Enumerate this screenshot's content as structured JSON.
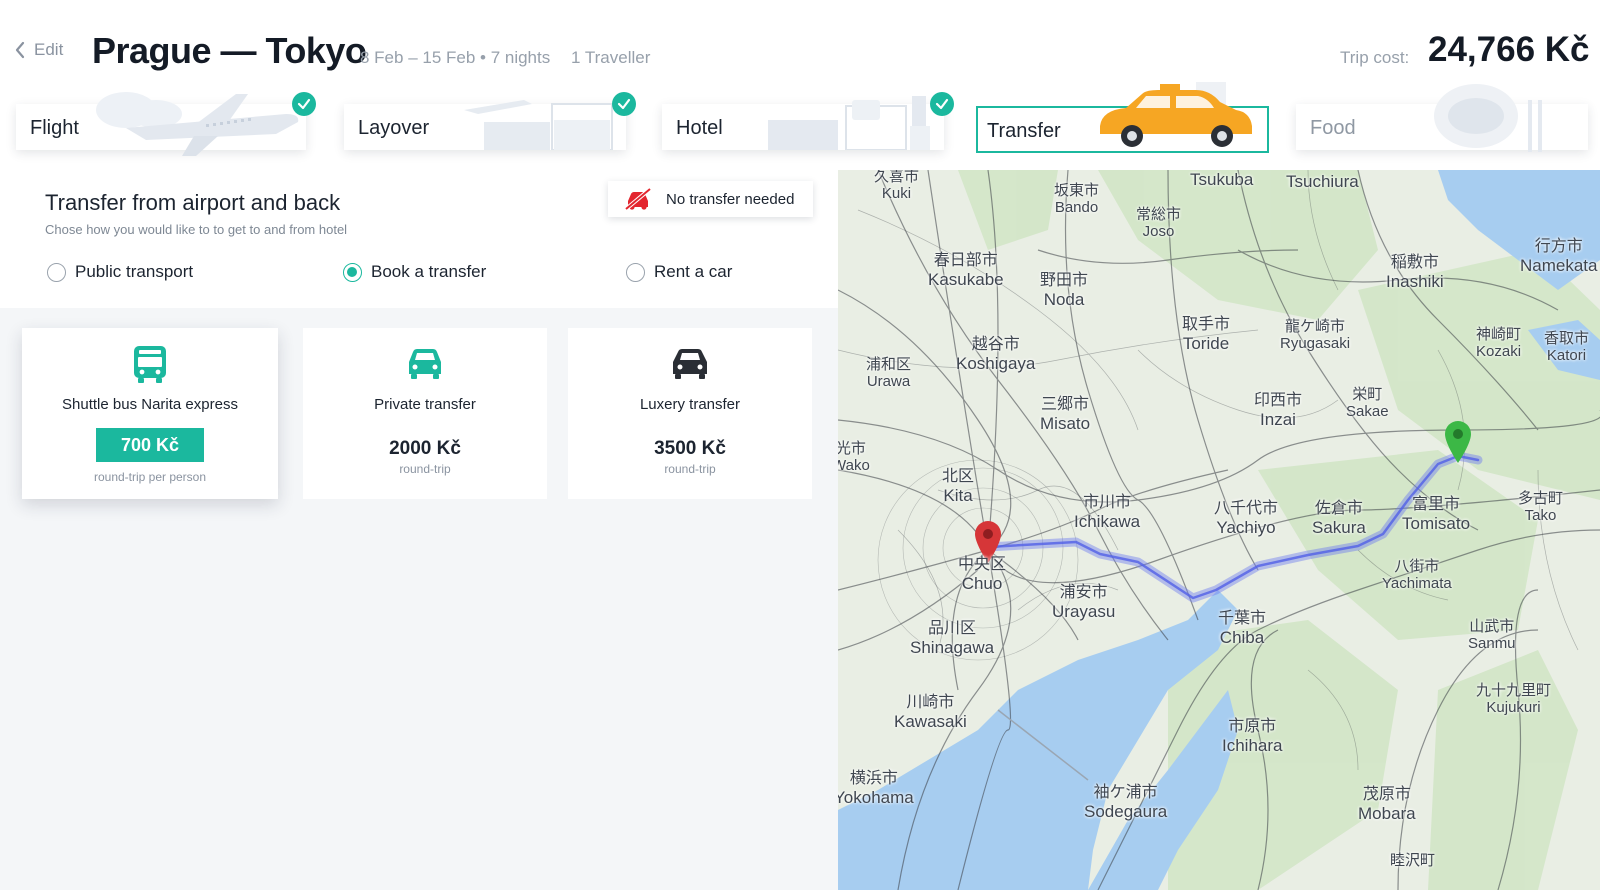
{
  "header": {
    "edit_label": "Edit",
    "title": "Prague — Tokyo",
    "dates": "8 Feb – 15 Feb • 7 nights",
    "travellers": "1 Traveller",
    "cost_label": "Trip cost:",
    "cost_value": "24,766 Kč"
  },
  "steps": [
    {
      "label": "Flight",
      "done": true
    },
    {
      "label": "Layover",
      "done": true
    },
    {
      "label": "Hotel",
      "done": true
    },
    {
      "label": "Transfer",
      "active": true
    },
    {
      "label": "Food",
      "disabled": true
    }
  ],
  "transfer": {
    "title": "Transfer from airport and back",
    "subtitle": "Chose how you would like to to get to and from hotel",
    "no_transfer_label": "No transfer needed",
    "options": [
      {
        "label": "Public transport",
        "checked": false
      },
      {
        "label": "Book a transfer",
        "checked": true
      },
      {
        "label": "Rent a car",
        "checked": false
      }
    ],
    "cards": [
      {
        "name": "Shuttle bus Narita express",
        "price": "700 Kč",
        "note": "round-trip per person",
        "icon": "bus-icon",
        "selected": true
      },
      {
        "name": "Private transfer",
        "price": "2000 Kč",
        "note": "round-trip",
        "icon": "car-icon",
        "selected": false
      },
      {
        "name": "Luxery transfer",
        "price": "3500 Kč",
        "note": "round-trip",
        "icon": "luxury-car-icon",
        "selected": false
      }
    ]
  },
  "map": {
    "labels": [
      {
        "jp": "久喜市",
        "en": "Kuki"
      },
      {
        "jp": "",
        "en": "Tsukuba"
      },
      {
        "jp": "",
        "en": "Tsuchiura"
      },
      {
        "jp": "坂東市",
        "en": "Bando"
      },
      {
        "jp": "常総市",
        "en": "Joso"
      },
      {
        "jp": "行方市",
        "en": "Namekata"
      },
      {
        "jp": "春日部市",
        "en": "Kasukabe"
      },
      {
        "jp": "野田市",
        "en": "Noda"
      },
      {
        "jp": "稲敷市",
        "en": "Inashiki"
      },
      {
        "jp": "取手市",
        "en": "Toride"
      },
      {
        "jp": "龍ケ崎市",
        "en": "Ryugasaki"
      },
      {
        "jp": "越谷市",
        "en": "Koshigaya"
      },
      {
        "jp": "神崎町",
        "en": "Kozaki"
      },
      {
        "jp": "香取市",
        "en": "Katori"
      },
      {
        "jp": "浦和区",
        "en": "Urawa"
      },
      {
        "jp": "三郷市",
        "en": "Misato"
      },
      {
        "jp": "印西市",
        "en": "Inzai"
      },
      {
        "jp": "栄町",
        "en": "Sakae"
      },
      {
        "jp": "北区",
        "en": "Kita"
      },
      {
        "jp": "市川市",
        "en": "Ichikawa"
      },
      {
        "jp": "八千代市",
        "en": "Yachiyo"
      },
      {
        "jp": "佐倉市",
        "en": "Sakura"
      },
      {
        "jp": "富里市",
        "en": "Tomisato"
      },
      {
        "jp": "多古町",
        "en": "Tako"
      },
      {
        "jp": "中央区",
        "en": "Chuo"
      },
      {
        "jp": "八街市",
        "en": "Yachimata"
      },
      {
        "jp": "浦安市",
        "en": "Urayasu"
      },
      {
        "jp": "品川区",
        "en": "Shinagawa"
      },
      {
        "jp": "千葉市",
        "en": "Chiba"
      },
      {
        "jp": "山武市",
        "en": "Sanmu"
      },
      {
        "jp": "川崎市",
        "en": "Kawasaki"
      },
      {
        "jp": "市原市",
        "en": "Ichihara"
      },
      {
        "jp": "九十九里町",
        "en": "Kujukuri"
      },
      {
        "jp": "横浜市",
        "en": "Yokohama"
      },
      {
        "jp": "袖ケ浦市",
        "en": "Sodegaura"
      },
      {
        "jp": "茂原市",
        "en": "Mobara"
      },
      {
        "jp": "睦沢町",
        "en": ""
      },
      {
        "jp": "光市",
        "en": "Wako"
      }
    ],
    "colors": {
      "land": "#e9eee4",
      "green": "#cfe5c3",
      "water": "#a7cdf0",
      "route": "#6f7df0",
      "origin_pin": "#d63638",
      "destination_pin": "#3cb846"
    }
  }
}
